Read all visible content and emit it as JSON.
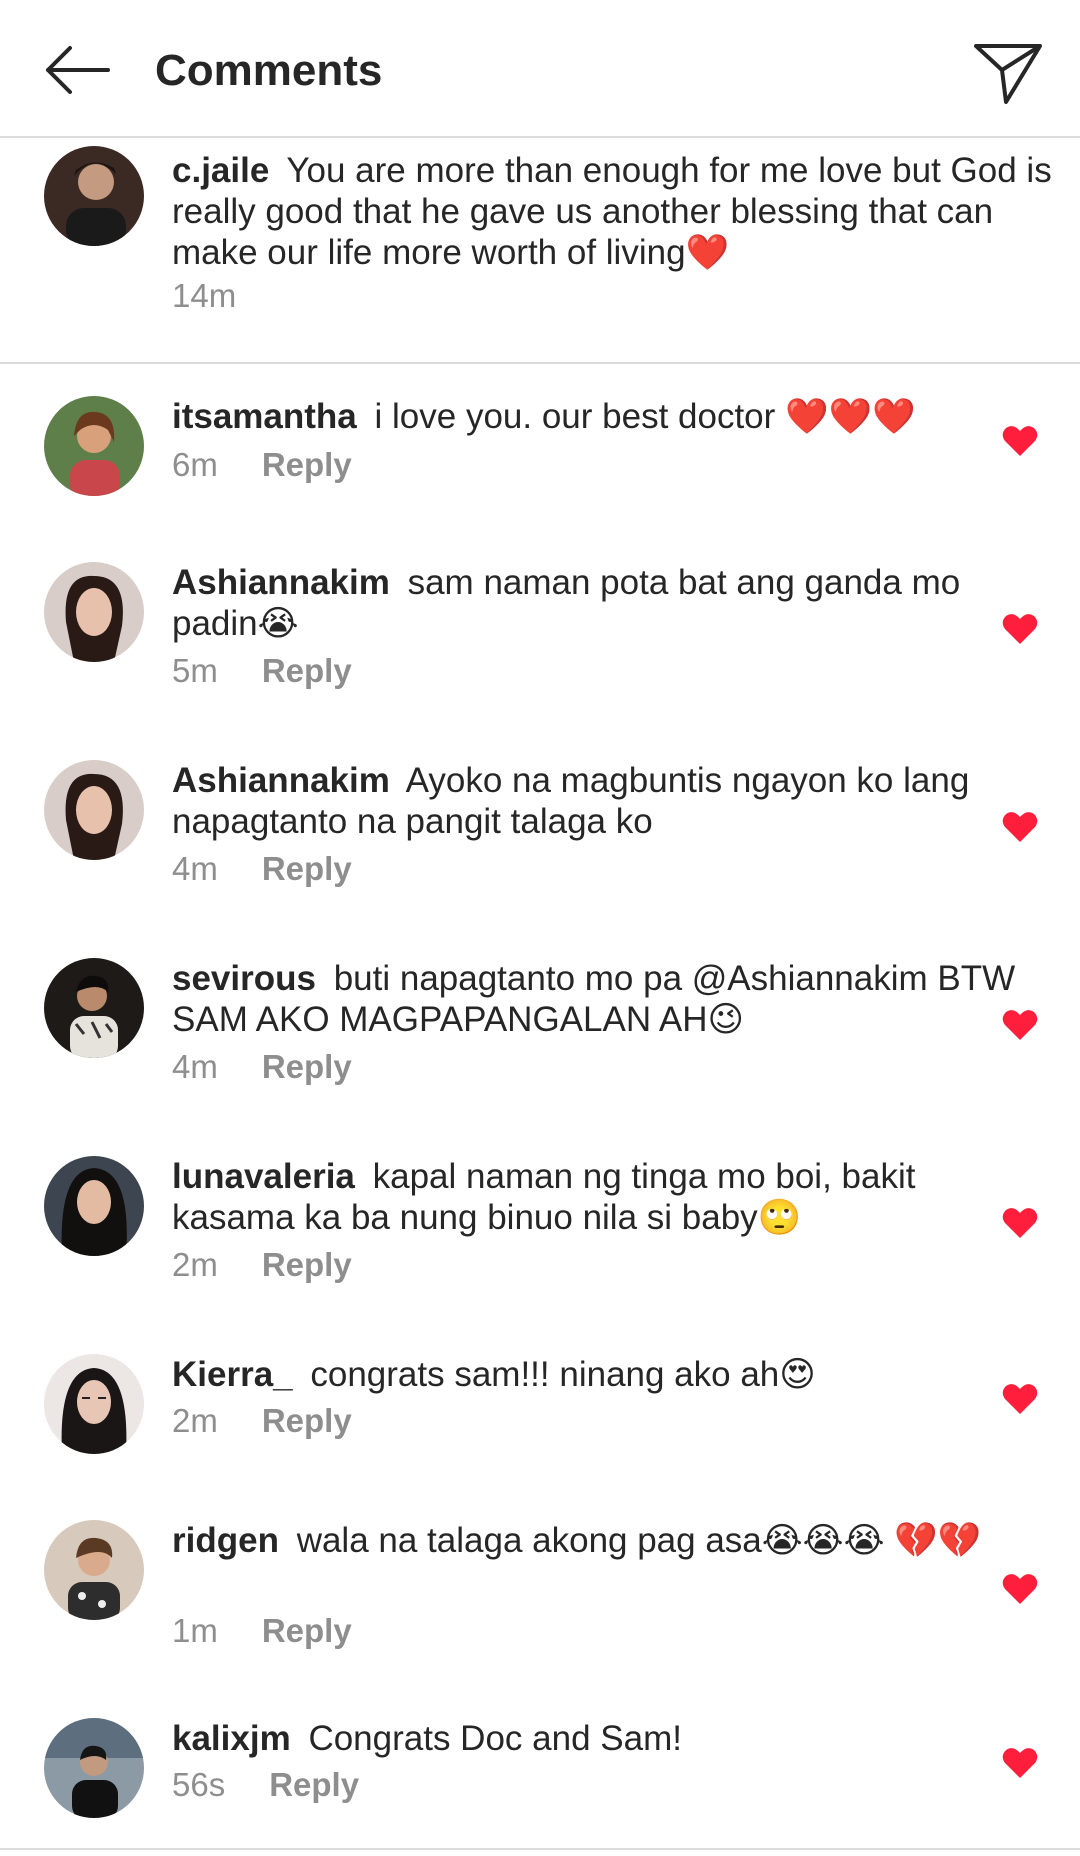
{
  "header": {
    "title": "Comments",
    "back_icon": "arrow-left-icon",
    "share_icon": "paper-plane-icon"
  },
  "colors": {
    "like": "#ff1f3d",
    "meta": "#8e8e8e",
    "divider": "#dbdbdb"
  },
  "caption": {
    "username": "c.jaile",
    "text": "You are more than enough for me love but God is really good that he gave us another blessing that can make our life more worth of living❤️",
    "time": "14m"
  },
  "reply_label": "Reply",
  "comments": [
    {
      "username": "itsamantha",
      "text": "i love you. our best doctor ❤️❤️❤️",
      "time": "6m"
    },
    {
      "username": "Ashiannakim",
      "text": "sam naman pota bat ang ganda mo padin😭",
      "time": "5m"
    },
    {
      "username": "Ashiannakim",
      "text": "Ayoko na magbuntis ngayon ko lang napagtanto na pangit talaga ko",
      "time": "4m"
    },
    {
      "username": "sevirous",
      "text": "buti napagtanto mo pa @Ashiannakim BTW SAM AKO MAGPAPANGALAN AH😉",
      "time": "4m"
    },
    {
      "username": "lunavaleria",
      "text": "kapal naman ng tinga mo boi, bakit kasama ka ba nung binuo nila si baby🙄",
      "time": "2m"
    },
    {
      "username": "Kierra_",
      "text": "congrats sam!!! ninang ako ah😍",
      "time": "2m"
    },
    {
      "username": "ridgen",
      "text": "wala na talaga akong pag asa😭😭😭 💔💔",
      "time": "1m"
    },
    {
      "username": "kalixjm",
      "text": "Congrats Doc and Sam!",
      "time": "56s"
    }
  ]
}
